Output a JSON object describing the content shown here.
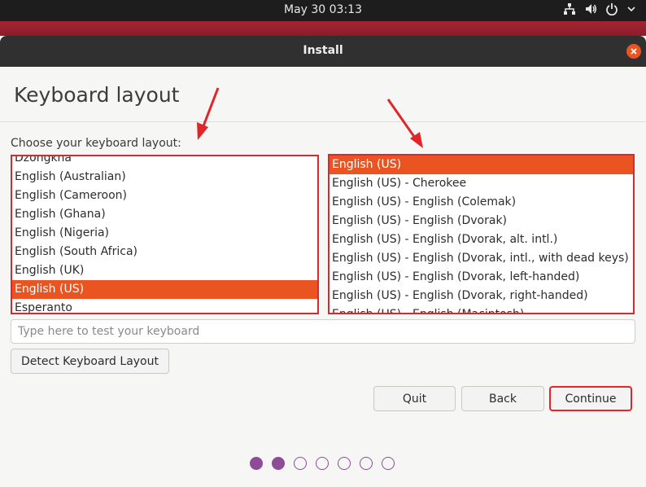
{
  "topbar": {
    "clock": "May 30  03:13",
    "icons": [
      "network-icon",
      "volume-icon",
      "power-icon",
      "chevron-down-icon"
    ]
  },
  "window": {
    "title": "Install"
  },
  "page": {
    "title": "Keyboard layout",
    "choose_label": "Choose your keyboard layout:"
  },
  "layouts": [
    "Dzongkha",
    "English (Australian)",
    "English (Cameroon)",
    "English (Ghana)",
    "English (Nigeria)",
    "English (South Africa)",
    "English (UK)",
    "English (US)",
    "Esperanto"
  ],
  "layouts_selected": 7,
  "variants": [
    "English (US)",
    "English (US) - Cherokee",
    "English (US) - English (Colemak)",
    "English (US) - English (Dvorak)",
    "English (US) - English (Dvorak, alt. intl.)",
    "English (US) - English (Dvorak, intl., with dead keys)",
    "English (US) - English (Dvorak, left-handed)",
    "English (US) - English (Dvorak, right-handed)",
    "English (US) - English (Macintosh)"
  ],
  "variants_selected": 0,
  "test_input": {
    "placeholder": "Type here to test your keyboard",
    "value": ""
  },
  "buttons": {
    "detect": "Detect Keyboard Layout",
    "quit": "Quit",
    "back": "Back",
    "continue": "Continue"
  },
  "progress": {
    "total_steps": 7,
    "completed_steps": 2
  },
  "colors": {
    "accent": "#e95420",
    "highlight_border": "#e0262a",
    "step_dot": "#8e4b96"
  }
}
